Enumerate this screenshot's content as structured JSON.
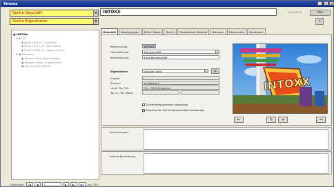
{
  "window": {
    "title": "Kinewa"
  },
  "search": {
    "business": "Suche Geschäft",
    "owner": "Suche Eigentümer"
  },
  "header": {
    "name": "INTOXX",
    "small_label": "Geschäft-Nr.",
    "buttons": [
      "Neu",
      "≡"
    ]
  },
  "tree": {
    "items": [
      {
        "label": "INTOXX",
        "bold": true,
        "indent": 0
      },
      {
        "label": "Ort",
        "bold": false,
        "indent": 1
      },
      {
        "label": "Ställe 2008 (0 - Generell)",
        "bold": false,
        "indent": 2
      },
      {
        "label": "Ställe 2007 (10 - Fahrzeiten)",
        "bold": false,
        "indent": 2
      },
      {
        "label": "Ställe 2008 (11 - Abgerechnet)",
        "bold": false,
        "indent": 2
      },
      {
        "label": "Personen",
        "bold": false,
        "indent": 1
      },
      {
        "label": "Wunder Hans (Eigentümer)",
        "bold": false,
        "indent": 2
      },
      {
        "label": "Strasser Anton (Eigentümer)",
        "bold": false,
        "indent": 2
      },
      {
        "label": "Jens Conrad (Fahrer)",
        "bold": false,
        "indent": 2
      }
    ]
  },
  "tabs": [
    "Geschäft",
    "Bewilligungen",
    "Techn. Daten",
    "Termin",
    "Zusätzliches Material",
    "Adressen",
    "Dokumente",
    "Pendenzen"
  ],
  "form": {
    "bezeichnung_label": "Bezeichnung:",
    "bezeichnung": "INTOXX",
    "geschaeftsart_label": "Geschäfts-Art:",
    "geschaeftsart": "Fahrgeschäft",
    "beschreibung_label": "Beschreibung:",
    "beschreibung": "Hochfahrgeschäft",
    "eigentuemer_label": "Eigentümer:",
    "eigentuemer": "Wunder Hans",
    "zusatz_label": "Zusatz:",
    "zusatz": "",
    "strasse_label": "Strasse:",
    "strasse": "Le Molard 7",
    "ort_label": "Land, Plz, Ort:",
    "ort": "CH - 9999 Musterort",
    "tel_label": "Tel. G / Tel. Mobil:",
    "tel1": "",
    "tel2": "",
    "check1": "Sicherheitsnachweis notwendig",
    "check2": "Elektrischer Sicherheitsnachweis notwendig"
  },
  "notes": {
    "bemerkungen_label": "Bemerkungen:",
    "intern_label": "Interne Bemerkung:"
  },
  "status": {
    "label": "Datensatz:",
    "current": "1",
    "total": "von 233"
  },
  "colors": {
    "search_bg": "#ffff73",
    "title_bg": "#0b2b86"
  }
}
